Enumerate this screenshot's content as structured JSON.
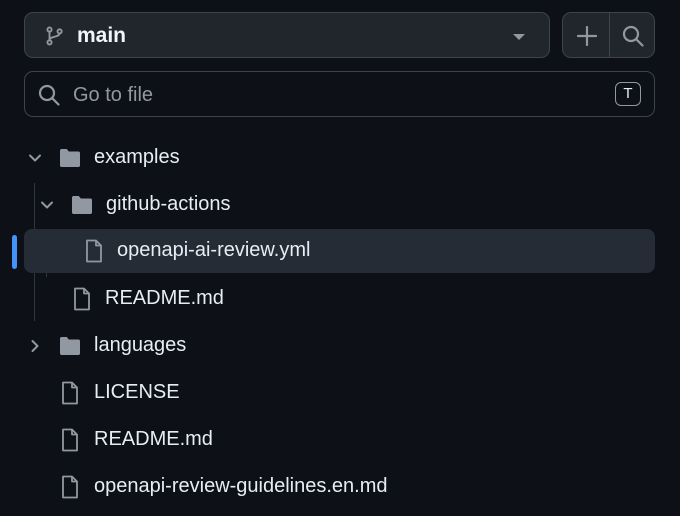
{
  "branch": {
    "name": "main"
  },
  "search": {
    "placeholder": "Go to file",
    "shortcut": "T"
  },
  "tree": [
    {
      "label": "examples",
      "type": "folder",
      "expanded": true,
      "depth": 0
    },
    {
      "label": "github-actions",
      "type": "folder",
      "expanded": true,
      "depth": 1
    },
    {
      "label": "openapi-ai-review.yml",
      "type": "file",
      "depth": 2,
      "selected": true
    },
    {
      "label": "README.md",
      "type": "file",
      "depth": 1
    },
    {
      "label": "languages",
      "type": "folder",
      "expanded": false,
      "depth": 0
    },
    {
      "label": "LICENSE",
      "type": "file",
      "depth": 0
    },
    {
      "label": "README.md",
      "type": "file",
      "depth": 0
    },
    {
      "label": "openapi-review-guidelines.en.md",
      "type": "file",
      "depth": 0
    }
  ],
  "colors": {
    "background": "#0d1117",
    "selected_row": "#262c36",
    "accent": "#4493f8",
    "icon": "#9198a1"
  }
}
